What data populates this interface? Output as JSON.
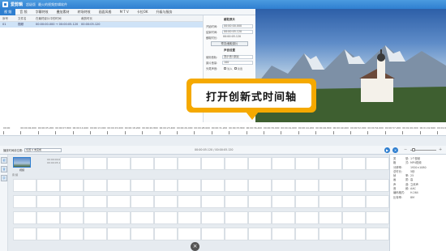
{
  "window": {
    "app_name": "爱剪辑",
    "subtitle_prefix": "超级版",
    "subtitle": "最火的视频剪辑软件"
  },
  "menu": [
    "视 频",
    "音 频",
    "字幕特效",
    "叠加素材",
    "转场特效",
    "画面风格",
    "M T V",
    "卡拉OK",
    "升级与服务"
  ],
  "clip_table": {
    "headers": [
      "序号",
      "文件名",
      "在最终影片中的时间",
      "裁剪时长"
    ],
    "rows": [
      [
        "01",
        "视频",
        "00:00:00.000 → 00:00:05.120",
        "00:00:05.120"
      ]
    ]
  },
  "settings": {
    "clip_title": "截取原片",
    "start_label": "开始时间:",
    "start_value": "00:00:00.000",
    "end_label": "结束时间:",
    "end_value": "00:00:05.120",
    "duration_label": "截取时长:",
    "duration_value": "00:00:05.120",
    "preview_btn": "预览/截取原片",
    "sound_title": "声音设置",
    "track_label": "使用音轨:",
    "track_value": "提示音1原始",
    "vol_label": "原片音量:",
    "vol_value": "100",
    "fade_label": "头尾声音:",
    "fade_in": "淡入",
    "fade_out": "淡出"
  },
  "callout": {
    "text": "打开创新式时间轴"
  },
  "ruler": {
    "labels": [
      "00:00",
      "00:00:02.600",
      "00:00:05.200",
      "00:00:07.800",
      "00:00:10.400",
      "00:00:13.000",
      "00:00:15.600",
      "00:00:18.200",
      "00:00:20.800",
      "00:00:23.400",
      "00:00:26.000",
      "00:00:28.600",
      "00:00:31.200",
      "00:00:33.800",
      "00:00:36.400",
      "00:00:39.000",
      "00:00:41.600",
      "00:00:44.200",
      "00:00:46.800",
      "00:00:49.400",
      "00:00:52.000",
      "00:00:54.600",
      "00:00:57.200",
      "00:01:00.000",
      "00:01:02.600",
      "00:01:05.200"
    ]
  },
  "timeline_bar": {
    "label": "播放时间线位置:",
    "select": "位置 0 未完成",
    "time": "00:00:05.120 / 00:00:05.120",
    "play_icon": "play-icon",
    "stop_icon": "stop-icon",
    "zoom_level": 0.1
  },
  "side_tabs": [
    "视",
    "音",
    "字"
  ],
  "tracks": {
    "clip_name": "视频",
    "clip_meta": [
      "00:00:00.000",
      "00:00:05.120"
    ],
    "audio_label": "音 频"
  },
  "properties": [
    [
      "类",
      "型:",
      "1个视频"
    ],
    [
      "格",
      "式:",
      "MP4视频"
    ],
    [
      "分辨率:",
      "",
      "1920×1080"
    ],
    [
      "总时长:",
      "",
      "5秒"
    ],
    [
      "帧",
      "率:",
      "25"
    ],
    [
      "画",
      "质:",
      "高"
    ],
    [
      "声",
      "道:",
      "立体声"
    ],
    [
      "音",
      "频:",
      "AAC"
    ],
    [
      "编码格式:",
      "",
      "H.264"
    ],
    [
      "比特率:",
      "",
      "8M"
    ]
  ]
}
